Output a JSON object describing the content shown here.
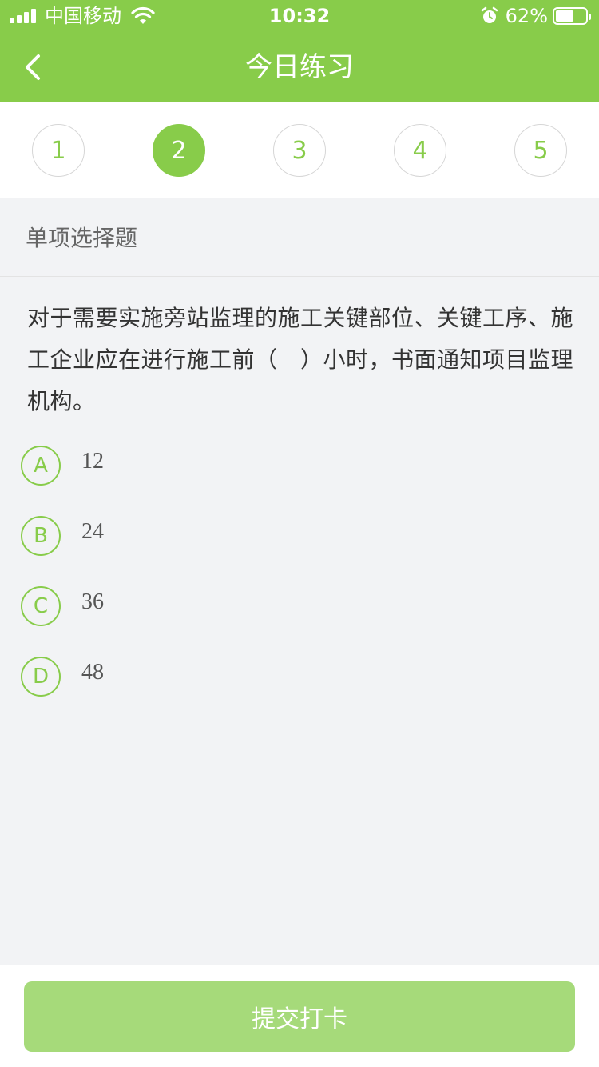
{
  "status_bar": {
    "carrier": "中国移动",
    "time": "10:32",
    "battery_percent": "62%",
    "battery_level": 0.62,
    "icons": [
      "signal-icon",
      "wifi-icon",
      "alarm-icon",
      "battery-icon"
    ]
  },
  "nav": {
    "title": "今日练习",
    "back_icon": "chevron-left-icon"
  },
  "question_numbers": {
    "items": [
      "1",
      "2",
      "3",
      "4",
      "5"
    ],
    "active_index": 1
  },
  "question": {
    "type": "单项选择题",
    "text": "对于需要实施旁站监理的施工关键部位、关键工序、施工企业应在进行施工前（　）小时，书面通知项目监理机构。",
    "options": [
      {
        "letter": "A",
        "text": "12"
      },
      {
        "letter": "B",
        "text": "24"
      },
      {
        "letter": "C",
        "text": "36"
      },
      {
        "letter": "D",
        "text": "48"
      }
    ]
  },
  "footer": {
    "submit_label": "提交打卡"
  },
  "colors": {
    "accent": "#88cc4a",
    "submit_disabled": "#a6da7a",
    "background": "#f2f3f5"
  }
}
